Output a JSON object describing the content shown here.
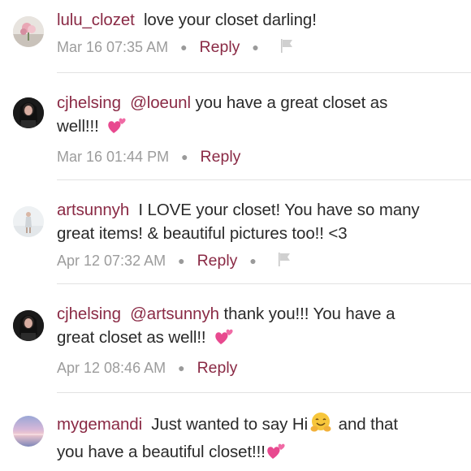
{
  "comments": [
    {
      "username": "lulu_clozet",
      "mention": "",
      "lines": [
        "love your closet darling!"
      ],
      "time": "Mar 16 07:35 AM",
      "reply": "Reply",
      "has_flag": true,
      "avatar": "avatar-flowers"
    },
    {
      "username": "cjhelsing",
      "mention": "@loeunl",
      "lines": [
        "you have a great closet as",
        "well!!!"
      ],
      "time": "Mar 16 01:44 PM",
      "reply": "Reply",
      "has_flag": false,
      "avatar": "avatar-portrait"
    },
    {
      "username": "artsunnyh",
      "mention": "",
      "lines": [
        "I LOVE your closet! You have so many",
        "great items! & beautiful pictures too!! <3"
      ],
      "time": "Apr 12 07:32 AM",
      "reply": "Reply",
      "has_flag": true,
      "avatar": "avatar-figure"
    },
    {
      "username": "cjhelsing",
      "mention": "@artsunnyh",
      "lines": [
        "thank you!!! You have a",
        "great closet as well!!"
      ],
      "time": "Apr 12 08:46 AM",
      "reply": "Reply",
      "has_flag": false,
      "avatar": "avatar-portrait"
    },
    {
      "username": "mygemandi",
      "mention": "",
      "lines": [
        "Just wanted to say Hi",
        "and that",
        "you have a beautiful closet!!!"
      ],
      "time": "",
      "reply": "",
      "has_flag": false,
      "avatar": "avatar-sky"
    }
  ],
  "icons": {
    "heart": "two-hearts-icon",
    "hug": "hugging-face-icon",
    "flag": "flag-icon"
  },
  "colors": {
    "username": "#8a2a45",
    "meta": "#9c9c9c",
    "divider": "#e2e2e2"
  }
}
